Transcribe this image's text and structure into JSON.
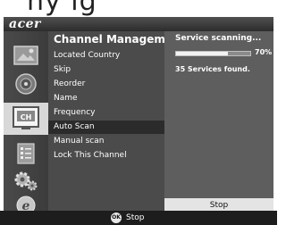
{
  "window": {
    "brand": "acer",
    "heading_fragment": "ny ig"
  },
  "sidebar": {
    "icons": [
      {
        "name": "picture-icon",
        "selected": false
      },
      {
        "name": "audio-icon",
        "selected": false
      },
      {
        "name": "channel-icon",
        "selected": true,
        "label": "CH"
      },
      {
        "name": "list-icon",
        "selected": false
      },
      {
        "name": "settings-icon",
        "selected": false
      },
      {
        "name": "internet-icon",
        "selected": false
      }
    ]
  },
  "menu": {
    "title": "Channel Manageme",
    "items": [
      {
        "label": "Located Country",
        "selected": false
      },
      {
        "label": "Skip",
        "selected": false
      },
      {
        "label": "Reorder",
        "selected": false
      },
      {
        "label": "Name",
        "selected": false
      },
      {
        "label": "Frequency",
        "selected": false
      },
      {
        "label": "Auto Scan",
        "selected": true
      },
      {
        "label": "Manual scan",
        "selected": false
      },
      {
        "label": "Lock This Channel",
        "selected": false
      }
    ]
  },
  "scan": {
    "title": "Service scanning...",
    "progress_fraction": 0.7,
    "percent_label": "70%",
    "found_text": "35 Services found.",
    "stop_label": "Stop"
  },
  "footer": {
    "ok_icon_text": "OK",
    "ok_label": "Stop"
  },
  "colors": {
    "selected_icon_bg": "#d8d8d8",
    "selected_menu_bg": "#2b2b2b",
    "menu_bg": "#4b4b4b",
    "panel_bg": "#5e5e5e"
  }
}
